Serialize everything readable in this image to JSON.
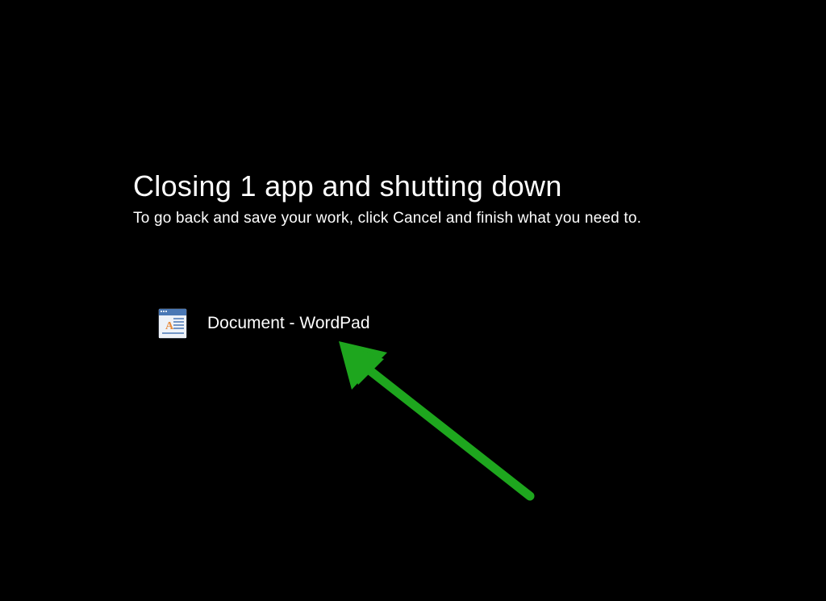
{
  "screen": {
    "title": "Closing 1 app and shutting down",
    "subtitle": "To go back and save your work, click Cancel and finish what you need to."
  },
  "apps": [
    {
      "name": "Document - WordPad",
      "icon": "wordpad-icon"
    }
  ],
  "colors": {
    "background": "#000000",
    "text": "#ffffff",
    "arrow": "#1ea61e"
  }
}
